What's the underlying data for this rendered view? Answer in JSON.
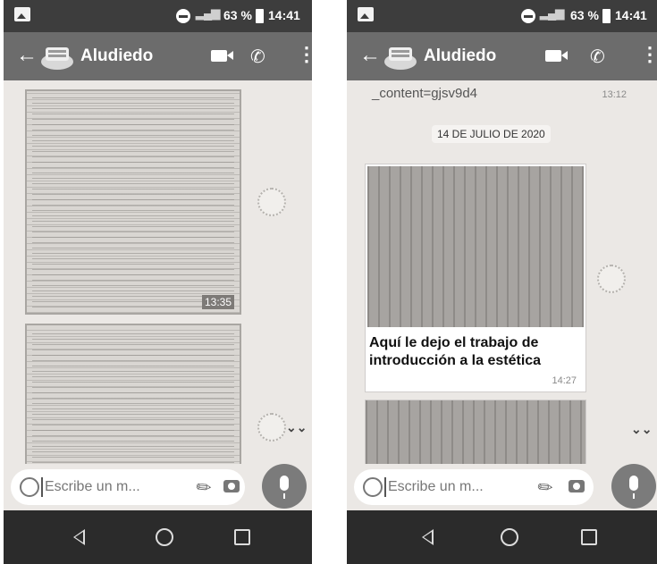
{
  "left_screen": {
    "status": {
      "battery_pct": "63 %",
      "time": "14:41"
    },
    "header": {
      "back": "←",
      "contact_name": "Aludiedo"
    },
    "messages": [
      {
        "type": "document-image",
        "time": "13:35"
      },
      {
        "type": "document-image"
      }
    ],
    "composer": {
      "placeholder": "Escribe un m..."
    }
  },
  "right_screen": {
    "status": {
      "battery_pct": "63 %",
      "time": "14:41"
    },
    "header": {
      "back": "←",
      "contact_name": "Aludiedo"
    },
    "snippet": {
      "text": "_content=gjsv9d4",
      "time": "13:12"
    },
    "date_separator": "14 DE JULIO DE 2020",
    "image_message": {
      "caption": "Aquí le dejo el trabajo de introducción a la estética",
      "time": "14:27"
    },
    "composer": {
      "placeholder": "Escribe un m..."
    }
  },
  "colors": {
    "status_bar": "#3d3d3d",
    "app_bar": "#6c6c6c",
    "chat_background": "#ebe8e5",
    "nav_bar": "#2b2b2b",
    "mic_button": "#7b7b7b"
  },
  "icons": [
    "gallery-icon",
    "dnd-icon",
    "signal-icon",
    "battery-icon",
    "back-arrow-icon",
    "avatar-icon",
    "video-call-icon",
    "phone-icon",
    "more-vert-icon",
    "emoji-icon",
    "attach-icon",
    "camera-icon",
    "mic-icon",
    "chevron-down-icon",
    "nav-back-icon",
    "nav-home-icon",
    "nav-recent-icon"
  ]
}
